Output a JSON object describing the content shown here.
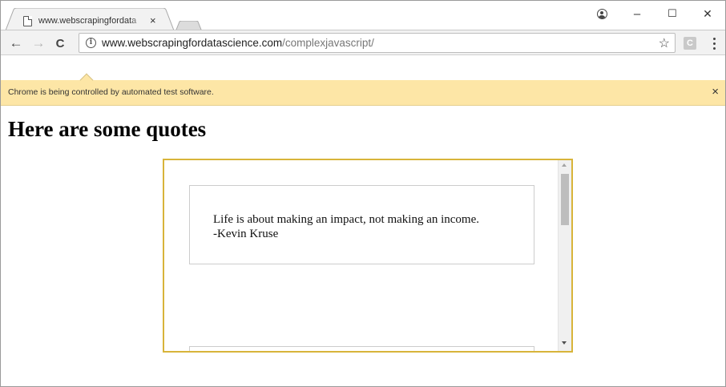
{
  "browser": {
    "tab": {
      "title": "www.webscrapingfordata",
      "close_glyph": "×",
      "icon": "page-icon"
    },
    "window_controls": {
      "profile": "profile-icon",
      "minimize": "–",
      "maximize": "☐",
      "close": "✕"
    },
    "toolbar": {
      "back": "←",
      "forward": "→",
      "reload": "C",
      "info_glyph": "i",
      "url_host": "www.webscrapingfordatascience.com",
      "url_path": "/complexjavascript/",
      "bookmark": "☆",
      "extension_label": "C"
    }
  },
  "infobar": {
    "message": "Chrome is being controlled by automated test software.",
    "close_glyph": "×"
  },
  "page": {
    "heading": "Here are some quotes",
    "quotes": [
      {
        "text": "Life is about making an impact, not making an income.",
        "author": "-Kevin Kruse"
      }
    ]
  },
  "colors": {
    "infobar_bg": "#fde6a6",
    "iframe_border": "#d8b43a",
    "toolbar_bg": "#f2f2f2"
  }
}
